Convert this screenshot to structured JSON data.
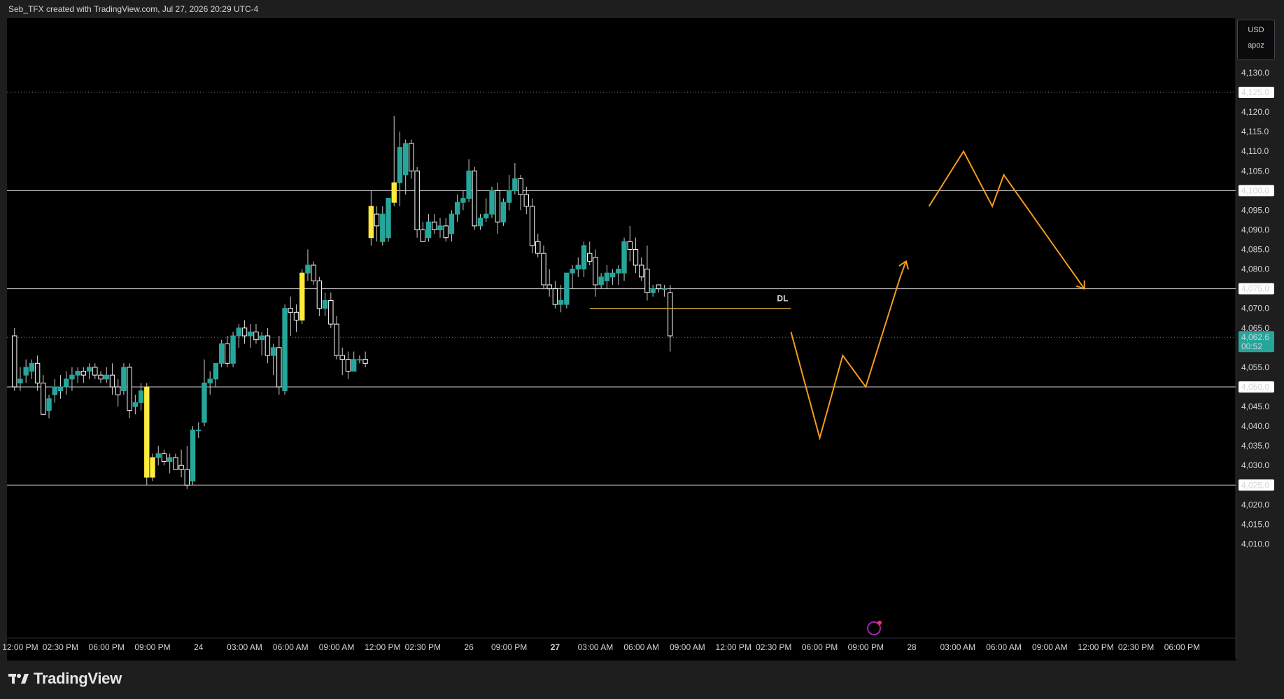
{
  "header": {
    "text": "Seb_TFX created with TradingView.com, Jul 27, 2026 20:29 UTC-4"
  },
  "scale_box": {
    "currency": "USD",
    "label": "apoz"
  },
  "brand": {
    "name": "TradingView"
  },
  "colors": {
    "bull": "#26a69a",
    "bear": "#ffffff",
    "highlight": "#ffeb3b",
    "wick": "#cccccc",
    "projection": "#f59b1f",
    "dl_line": "#c8a032",
    "current_price_bg": "#26a69a",
    "hline": "#cfcfcf"
  },
  "icons": [
    "tradingview-logo-icon",
    "lightning-alert-icon"
  ],
  "chart_data": {
    "type": "candlestick",
    "symbol_axis": "price",
    "ylim": [
      4006,
      4137
    ],
    "y_ticks": [
      "4,130.0",
      "4,125.0",
      "4,120.0",
      "4,115.0",
      "4,110.0",
      "4,105.0",
      "4,100.0",
      "4,095.0",
      "4,090.0",
      "4,085.0",
      "4,080.0",
      "4,075.0",
      "4,070.0",
      "4,065.0",
      "4,062.6",
      "4,055.0",
      "4,050.0",
      "4,045.0",
      "4,040.0",
      "4,035.0",
      "4,030.0",
      "4,025.0",
      "4,020.0",
      "4,015.0",
      "4,010.0"
    ],
    "y_tick_values": [
      4130,
      4125,
      4120,
      4115,
      4110,
      4105,
      4100,
      4095,
      4090,
      4085,
      4080,
      4075,
      4070,
      4065,
      4062.6,
      4055,
      4050,
      4045,
      4040,
      4035,
      4030,
      4025,
      4020,
      4015,
      4010
    ],
    "highlighted_levels": [
      {
        "label": "4,125.0",
        "value": 4125,
        "style": "dotted"
      },
      {
        "label": "4,100.0",
        "value": 4100,
        "style": "solid"
      },
      {
        "label": "4,075.0",
        "value": 4075,
        "style": "solid"
      },
      {
        "label": "4,050.0",
        "value": 4050,
        "style": "solid"
      },
      {
        "label": "4,025.0",
        "value": 4025,
        "style": "solid"
      }
    ],
    "current_price": {
      "label": "4,062.6",
      "countdown": "00:52",
      "value": 4062.6
    },
    "x_ticks": [
      "12:00 PM",
      "02:30 PM",
      "06:00 PM",
      "09:00 PM",
      "24",
      "03:00 AM",
      "06:00 AM",
      "09:00 AM",
      "12:00 PM",
      "02:30 PM",
      "26",
      "09:00 PM",
      "27",
      "03:00 AM",
      "06:00 AM",
      "09:00 AM",
      "12:00 PM",
      "02:30 PM",
      "06:00 PM",
      "09:00 PM",
      "28",
      "03:00 AM",
      "06:00 AM",
      "09:00 AM",
      "12:00 PM",
      "02:30 PM",
      "06:00 PM"
    ],
    "x_tick_slots": [
      2,
      9,
      17,
      25,
      33,
      41,
      49,
      57,
      65,
      72,
      80,
      87,
      95,
      102,
      110,
      118,
      126,
      133,
      141,
      149,
      157,
      165,
      173,
      181,
      189,
      196,
      204
    ],
    "bold_x_ticks": [
      12
    ],
    "slot_start": 1.0,
    "slot_step": 1.0,
    "candles": [
      {
        "o": 4063,
        "h": 4065,
        "l": 4049,
        "c": 4050
      },
      {
        "o": 4051,
        "h": 4055,
        "l": 4049,
        "c": 4052
      },
      {
        "o": 4053,
        "h": 4057,
        "l": 4051,
        "c": 4055
      },
      {
        "o": 4054,
        "h": 4057,
        "l": 4052,
        "c": 4056
      },
      {
        "o": 4056,
        "h": 4058,
        "l": 4049,
        "c": 4051
      },
      {
        "o": 4051,
        "h": 4053,
        "l": 4043,
        "c": 4043
      },
      {
        "o": 4044,
        "h": 4048,
        "l": 4042,
        "c": 4047
      },
      {
        "o": 4048,
        "h": 4052,
        "l": 4046,
        "c": 4050
      },
      {
        "o": 4049,
        "h": 4053,
        "l": 4047,
        "c": 4050
      },
      {
        "o": 4050,
        "h": 4054,
        "l": 4048,
        "c": 4052
      },
      {
        "o": 4052,
        "h": 4055,
        "l": 4049,
        "c": 4053
      },
      {
        "o": 4053,
        "h": 4055,
        "l": 4051,
        "c": 4054
      },
      {
        "o": 4054,
        "h": 4055,
        "l": 4051,
        "c": 4053
      },
      {
        "o": 4054,
        "h": 4056,
        "l": 4052,
        "c": 4055
      },
      {
        "o": 4055,
        "h": 4056,
        "l": 4052,
        "c": 4053
      },
      {
        "o": 4053,
        "h": 4054,
        "l": 4051,
        "c": 4052
      },
      {
        "o": 4052,
        "h": 4055,
        "l": 4051,
        "c": 4053
      },
      {
        "o": 4053,
        "h": 4056,
        "l": 4048,
        "c": 4050
      },
      {
        "o": 4050,
        "h": 4052,
        "l": 4045,
        "c": 4048
      },
      {
        "o": 4049,
        "h": 4056,
        "l": 4048,
        "c": 4055
      },
      {
        "o": 4055,
        "h": 4056,
        "l": 4042,
        "c": 4044
      },
      {
        "o": 4045,
        "h": 4048,
        "l": 4043,
        "c": 4046
      },
      {
        "o": 4046,
        "h": 4051,
        "l": 4044,
        "c": 4049
      },
      {
        "o": 4050,
        "h": 4051,
        "l": 4025,
        "c": 4027,
        "hl": true
      },
      {
        "o": 4027,
        "h": 4033,
        "l": 4026,
        "c": 4032,
        "hl": true
      },
      {
        "o": 4032,
        "h": 4035,
        "l": 4030,
        "c": 4033
      },
      {
        "o": 4033,
        "h": 4034,
        "l": 4030,
        "c": 4031
      },
      {
        "o": 4031,
        "h": 4033,
        "l": 4028,
        "c": 4032
      },
      {
        "o": 4032,
        "h": 4033,
        "l": 4029,
        "c": 4029
      },
      {
        "o": 4030,
        "h": 4034,
        "l": 4027,
        "c": 4029
      },
      {
        "o": 4029,
        "h": 4035,
        "l": 4024,
        "c": 4025
      },
      {
        "o": 4026,
        "h": 4040,
        "l": 4025,
        "c": 4039
      },
      {
        "o": 4039,
        "h": 4041,
        "l": 4037,
        "c": 4039
      },
      {
        "o": 4041,
        "h": 4057,
        "l": 4040,
        "c": 4051
      },
      {
        "o": 4051,
        "h": 4054,
        "l": 4048,
        "c": 4052
      },
      {
        "o": 4052,
        "h": 4056,
        "l": 4050,
        "c": 4056
      },
      {
        "o": 4056,
        "h": 4062,
        "l": 4055,
        "c": 4061
      },
      {
        "o": 4061,
        "h": 4063,
        "l": 4055,
        "c": 4056
      },
      {
        "o": 4056,
        "h": 4064,
        "l": 4055,
        "c": 4063
      },
      {
        "o": 4063,
        "h": 4066,
        "l": 4060,
        "c": 4065
      },
      {
        "o": 4065,
        "h": 4067,
        "l": 4061,
        "c": 4063
      },
      {
        "o": 4063,
        "h": 4066,
        "l": 4060,
        "c": 4064
      },
      {
        "o": 4064,
        "h": 4066,
        "l": 4061,
        "c": 4062
      },
      {
        "o": 4062,
        "h": 4064,
        "l": 4058,
        "c": 4063
      },
      {
        "o": 4063,
        "h": 4065,
        "l": 4056,
        "c": 4058
      },
      {
        "o": 4058,
        "h": 4061,
        "l": 4053,
        "c": 4060
      },
      {
        "o": 4060,
        "h": 4063,
        "l": 4048,
        "c": 4050
      },
      {
        "o": 4049,
        "h": 4071,
        "l": 4048,
        "c": 4070
      },
      {
        "o": 4070,
        "h": 4073,
        "l": 4063,
        "c": 4069
      },
      {
        "o": 4069,
        "h": 4071,
        "l": 4064,
        "c": 4067
      },
      {
        "o": 4067,
        "h": 4080,
        "l": 4066,
        "c": 4079,
        "hl": true
      },
      {
        "o": 4079,
        "h": 4085,
        "l": 4077,
        "c": 4081
      },
      {
        "o": 4081,
        "h": 4082,
        "l": 4076,
        "c": 4077
      },
      {
        "o": 4077,
        "h": 4078,
        "l": 4068,
        "c": 4070
      },
      {
        "o": 4070,
        "h": 4074,
        "l": 4068,
        "c": 4072
      },
      {
        "o": 4072,
        "h": 4074,
        "l": 4065,
        "c": 4066
      },
      {
        "o": 4066,
        "h": 4068,
        "l": 4057,
        "c": 4058
      },
      {
        "o": 4058,
        "h": 4060,
        "l": 4053,
        "c": 4057
      },
      {
        "o": 4057,
        "h": 4059,
        "l": 4052,
        "c": 4054
      },
      {
        "o": 4054,
        "h": 4059,
        "l": 4054,
        "c": 4057
      },
      {
        "o": 4057,
        "h": 4058,
        "l": 4056,
        "c": 4057
      },
      {
        "o": 4057,
        "h": 4059,
        "l": 4055,
        "c": 4056
      },
      {
        "o": 4088,
        "h": 4100,
        "l": 4086,
        "c": 4096,
        "hl": true
      },
      {
        "o": 4094,
        "h": 4096,
        "l": 4087,
        "c": 4091
      },
      {
        "o": 4087,
        "h": 4096,
        "l": 4086,
        "c": 4094
      },
      {
        "o": 4088,
        "h": 4098,
        "l": 4087,
        "c": 4098
      },
      {
        "o": 4097,
        "h": 4119,
        "l": 4096,
        "c": 4102,
        "hl": true
      },
      {
        "o": 4102,
        "h": 4115,
        "l": 4096,
        "c": 4111
      },
      {
        "o": 4104,
        "h": 4113,
        "l": 4099,
        "c": 4112
      },
      {
        "o": 4112,
        "h": 4113,
        "l": 4103,
        "c": 4105
      },
      {
        "o": 4105,
        "h": 4106,
        "l": 4088,
        "c": 4090
      },
      {
        "o": 4090,
        "h": 4092,
        "l": 4087,
        "c": 4087
      },
      {
        "o": 4088,
        "h": 4094,
        "l": 4087,
        "c": 4092
      },
      {
        "o": 4092,
        "h": 4094,
        "l": 4089,
        "c": 4090
      },
      {
        "o": 4090,
        "h": 4093,
        "l": 4088,
        "c": 4091
      },
      {
        "o": 4091,
        "h": 4093,
        "l": 4087,
        "c": 4088
      },
      {
        "o": 4089,
        "h": 4095,
        "l": 4087,
        "c": 4094
      },
      {
        "o": 4094,
        "h": 4099,
        "l": 4092,
        "c": 4097
      },
      {
        "o": 4097,
        "h": 4100,
        "l": 4095,
        "c": 4098
      },
      {
        "o": 4098,
        "h": 4108,
        "l": 4097,
        "c": 4105
      },
      {
        "o": 4105,
        "h": 4106,
        "l": 4090,
        "c": 4091
      },
      {
        "o": 4091,
        "h": 4094,
        "l": 4090,
        "c": 4093
      },
      {
        "o": 4093,
        "h": 4098,
        "l": 4092,
        "c": 4094
      },
      {
        "o": 4094,
        "h": 4101,
        "l": 4093,
        "c": 4100
      },
      {
        "o": 4100,
        "h": 4102,
        "l": 4089,
        "c": 4092
      },
      {
        "o": 4092,
        "h": 4098,
        "l": 4091,
        "c": 4097
      },
      {
        "o": 4097,
        "h": 4104,
        "l": 4095,
        "c": 4100
      },
      {
        "o": 4100,
        "h": 4107,
        "l": 4099,
        "c": 4103
      },
      {
        "o": 4103,
        "h": 4104,
        "l": 4095,
        "c": 4099
      },
      {
        "o": 4099,
        "h": 4101,
        "l": 4094,
        "c": 4096
      },
      {
        "o": 4096,
        "h": 4098,
        "l": 4084,
        "c": 4086
      },
      {
        "o": 4087,
        "h": 4089,
        "l": 4083,
        "c": 4084
      },
      {
        "o": 4084,
        "h": 4086,
        "l": 4075,
        "c": 4076
      },
      {
        "o": 4076,
        "h": 4080,
        "l": 4073,
        "c": 4075
      },
      {
        "o": 4075,
        "h": 4077,
        "l": 4070,
        "c": 4071
      },
      {
        "o": 4071,
        "h": 4076,
        "l": 4069,
        "c": 4072
      },
      {
        "o": 4071,
        "h": 4079,
        "l": 4070,
        "c": 4079
      },
      {
        "o": 4079,
        "h": 4081,
        "l": 4075,
        "c": 4080
      },
      {
        "o": 4080,
        "h": 4083,
        "l": 4078,
        "c": 4081
      },
      {
        "o": 4080,
        "h": 4087,
        "l": 4078,
        "c": 4086
      },
      {
        "o": 4084,
        "h": 4087,
        "l": 4081,
        "c": 4082
      },
      {
        "o": 4083,
        "h": 4085,
        "l": 4073,
        "c": 4076
      },
      {
        "o": 4076,
        "h": 4079,
        "l": 4075,
        "c": 4078
      },
      {
        "o": 4077,
        "h": 4081,
        "l": 4075,
        "c": 4079
      },
      {
        "o": 4078,
        "h": 4080,
        "l": 4076,
        "c": 4079
      },
      {
        "o": 4079,
        "h": 4081,
        "l": 4076,
        "c": 4080
      },
      {
        "o": 4079,
        "h": 4088,
        "l": 4077,
        "c": 4087
      },
      {
        "o": 4087,
        "h": 4091,
        "l": 4082,
        "c": 4085
      },
      {
        "o": 4085,
        "h": 4088,
        "l": 4079,
        "c": 4081
      },
      {
        "o": 4081,
        "h": 4083,
        "l": 4077,
        "c": 4078
      },
      {
        "o": 4080,
        "h": 4086,
        "l": 4072,
        "c": 4074
      },
      {
        "o": 4074,
        "h": 4076,
        "l": 4073,
        "c": 4075
      },
      {
        "o": 4076,
        "h": 4076,
        "l": 4074,
        "c": 4075
      },
      {
        "o": 4075,
        "h": 4076,
        "l": 4073,
        "c": 4075
      },
      {
        "o": 4074,
        "h": 4076,
        "l": 4059,
        "c": 4063
      }
    ],
    "annotations": [
      {
        "type": "hline",
        "label": "DL",
        "value": 4070,
        "from_slot": 101,
        "to_slot": 136
      },
      {
        "type": "path",
        "points_slot_price": [
          [
            136,
            4064
          ],
          [
            141,
            4037
          ],
          [
            145,
            4058
          ],
          [
            149,
            4050
          ],
          [
            155,
            4078
          ],
          [
            156,
            4082
          ]
        ]
      },
      {
        "type": "path",
        "points_slot_price": [
          [
            160,
            4096
          ],
          [
            166,
            4110
          ],
          [
            171,
            4096
          ],
          [
            173,
            4104
          ],
          [
            187,
            4075
          ]
        ]
      }
    ]
  }
}
